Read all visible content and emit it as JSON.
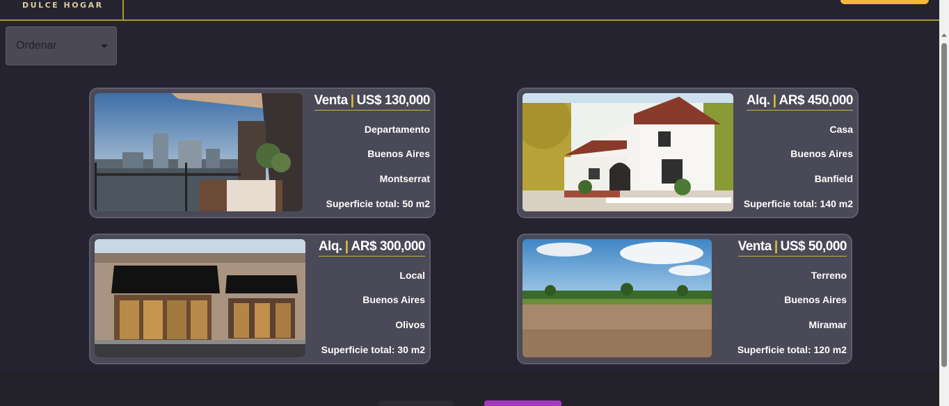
{
  "header": {
    "brand": "DULCE HOGAR"
  },
  "sort": {
    "label": "Ordenar"
  },
  "listings": [
    {
      "operation": "Venta",
      "price": "US$ 130,000",
      "type": "Departamento",
      "city": "Buenos Aires",
      "neighborhood": "Montserrat",
      "surface": "Superficie total: 50 m2",
      "photo": "apartment-balcony-city-view"
    },
    {
      "operation": "Alq.",
      "price": "AR$ 450,000",
      "type": "Casa",
      "city": "Buenos Aires",
      "neighborhood": "Banfield",
      "surface": "Superficie total: 140 m2",
      "photo": "white-two-story-house"
    },
    {
      "operation": "Alq.",
      "price": "AR$ 300,000",
      "type": "Local",
      "city": "Buenos Aires",
      "neighborhood": "Olivos",
      "surface": "Superficie total: 30 m2",
      "photo": "storefront-shop"
    },
    {
      "operation": "Venta",
      "price": "US$ 50,000",
      "type": "Terreno",
      "city": "Buenos Aires",
      "neighborhood": "Miramar",
      "surface": "Superficie total: 120 m2",
      "photo": "empty-land-field"
    }
  ],
  "colors": {
    "background": "#25232f",
    "card": "#4a4957",
    "accent_gold": "#e0c23a",
    "header_button": "#f5b83a",
    "footer_button": "#a23ac0"
  }
}
